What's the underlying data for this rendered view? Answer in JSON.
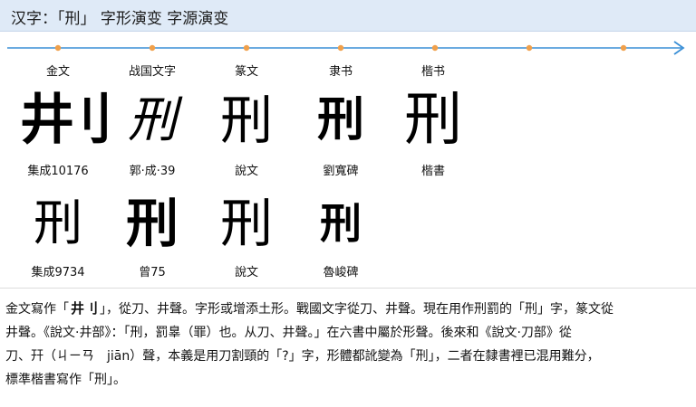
{
  "header": {
    "title": "汉字：「刑」 字形演变 字源演变"
  },
  "colors": {
    "timeline": "#3a8fd6",
    "marker": "#f0a04b",
    "header_bg": "#dfeaf7"
  },
  "timeline": {
    "marker_count": 7
  },
  "eras": [
    {
      "label": "金文"
    },
    {
      "label": "战国文字"
    },
    {
      "label": "篆文"
    },
    {
      "label": "隶书"
    },
    {
      "label": "楷书"
    }
  ],
  "glyphs_row1": [
    {
      "char": "井刂",
      "source": "集成10176"
    },
    {
      "char": "刑",
      "source": "郭·成·39"
    },
    {
      "char": "刑",
      "source": "說文"
    },
    {
      "char": "刑",
      "source": "劉寬碑"
    },
    {
      "char": "刑",
      "source": "楷書"
    }
  ],
  "glyphs_row2": [
    {
      "char": "刑",
      "source": "集成9734"
    },
    {
      "char": "刑",
      "source": "曾75"
    },
    {
      "char": "刑",
      "source": "說文"
    },
    {
      "char": "刑",
      "source": "魯峻碑"
    }
  ],
  "description": {
    "line1_a": "金文寫作「",
    "line1_glyph": "井刂",
    "line1_b": "」，從刀、井聲。字形或增添土形。戰國文字從刀、井聲。現在用作刑罰的「刑」字，篆文從",
    "line2": "井聲。《說文·井部》：「刑，罰辠（罪）也。从刀、井聲。」在六書中屬於形聲。後來和《說文·刀部》從",
    "line3": "刀、幵（ㄐㄧㄢ　jiān）聲，本義是用刀割頸的「?」字，形體都訛變為「刑」，二者在隸書裡已混用難分，",
    "line4": "標準楷書寫作「刑」。"
  }
}
